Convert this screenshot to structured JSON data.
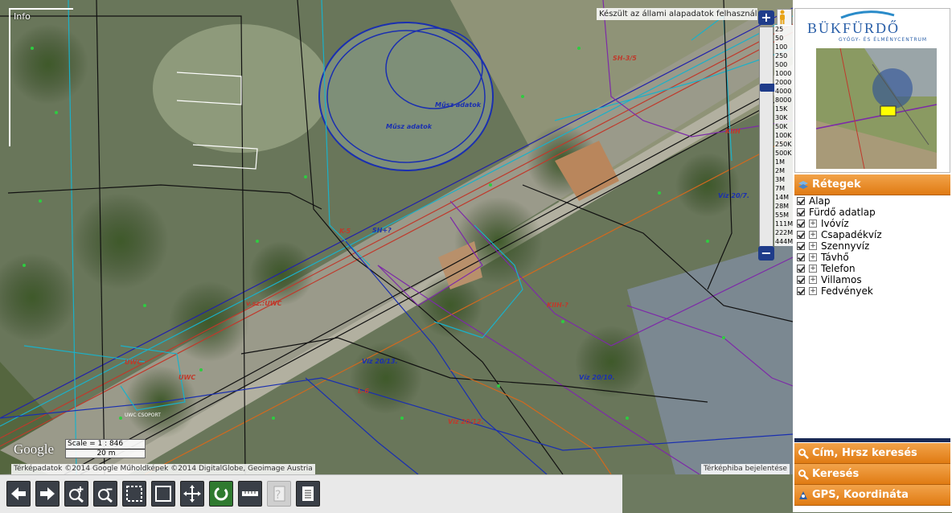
{
  "map": {
    "info_label": "Info",
    "attribution_top": "Készült az állami alapadatok felhasználásával",
    "scale_labels": [
      "25",
      "50",
      "100",
      "250",
      "500",
      "1000",
      "2000",
      "4000",
      "8000",
      "15K",
      "30K",
      "50K",
      "100K",
      "250K",
      "500K",
      "1M",
      "2M",
      "3M",
      "7M",
      "14M",
      "28M",
      "55M",
      "111M",
      "222M",
      "444M"
    ],
    "zoom_in": "+",
    "zoom_out": "−",
    "google_logo": "Google",
    "scale_text": "Scale = 1 : 846",
    "scale_bar": "20 m",
    "attribution_bottom": "Térképadatok ©2014 Google Műholdképek ©2014 DigitalGlobe, Geoimage Austria",
    "report_link": "Térképhiba bejelentése",
    "labels": [
      "Műsz adatok",
      "Műsz adatok",
      "v.sz.:UWC",
      "UWC",
      "UWC",
      "Víz 20/7.",
      "Víz 20/10.",
      "Víz 20/12.",
      "Víz 20/13.",
      "K-5",
      "SH+?",
      "L-6",
      "KIIH-?",
      "KIIH",
      "SH-3/5",
      "UWC CSOPORT"
    ]
  },
  "toolbar": {
    "tools": [
      "back-arrow-icon",
      "forward-arrow-icon",
      "zoom-in-icon",
      "zoom-out-icon",
      "zoom-box-icon",
      "full-extent-icon",
      "pan-icon",
      "refresh-icon",
      "measure-icon",
      "identify-icon",
      "print-icon"
    ]
  },
  "sidebar": {
    "logo_title": "BÜKFÜRDŐ",
    "logo_subtitle": "GYÓGY- ÉS ÉLMÉNYCENTRUM",
    "layers_header": "Rétegek",
    "layers": [
      {
        "label": "Alap",
        "expandable": false
      },
      {
        "label": "Fürdő adatlap",
        "expandable": false
      },
      {
        "label": "Ivóvíz",
        "expandable": true
      },
      {
        "label": "Csapadékvíz",
        "expandable": true
      },
      {
        "label": "Szennyvíz",
        "expandable": true
      },
      {
        "label": "Távhő",
        "expandable": true
      },
      {
        "label": "Telefon",
        "expandable": true
      },
      {
        "label": "Villamos",
        "expandable": true
      },
      {
        "label": "Fedvények",
        "expandable": true
      }
    ],
    "panels": [
      "Cím, Hrsz keresés",
      "Keresés",
      "GPS, Koordináta"
    ]
  },
  "colors": {
    "panel_orange": "#e8891f",
    "zoom_blue": "#1f3c8a",
    "logo_blue": "#2a5fa8"
  }
}
